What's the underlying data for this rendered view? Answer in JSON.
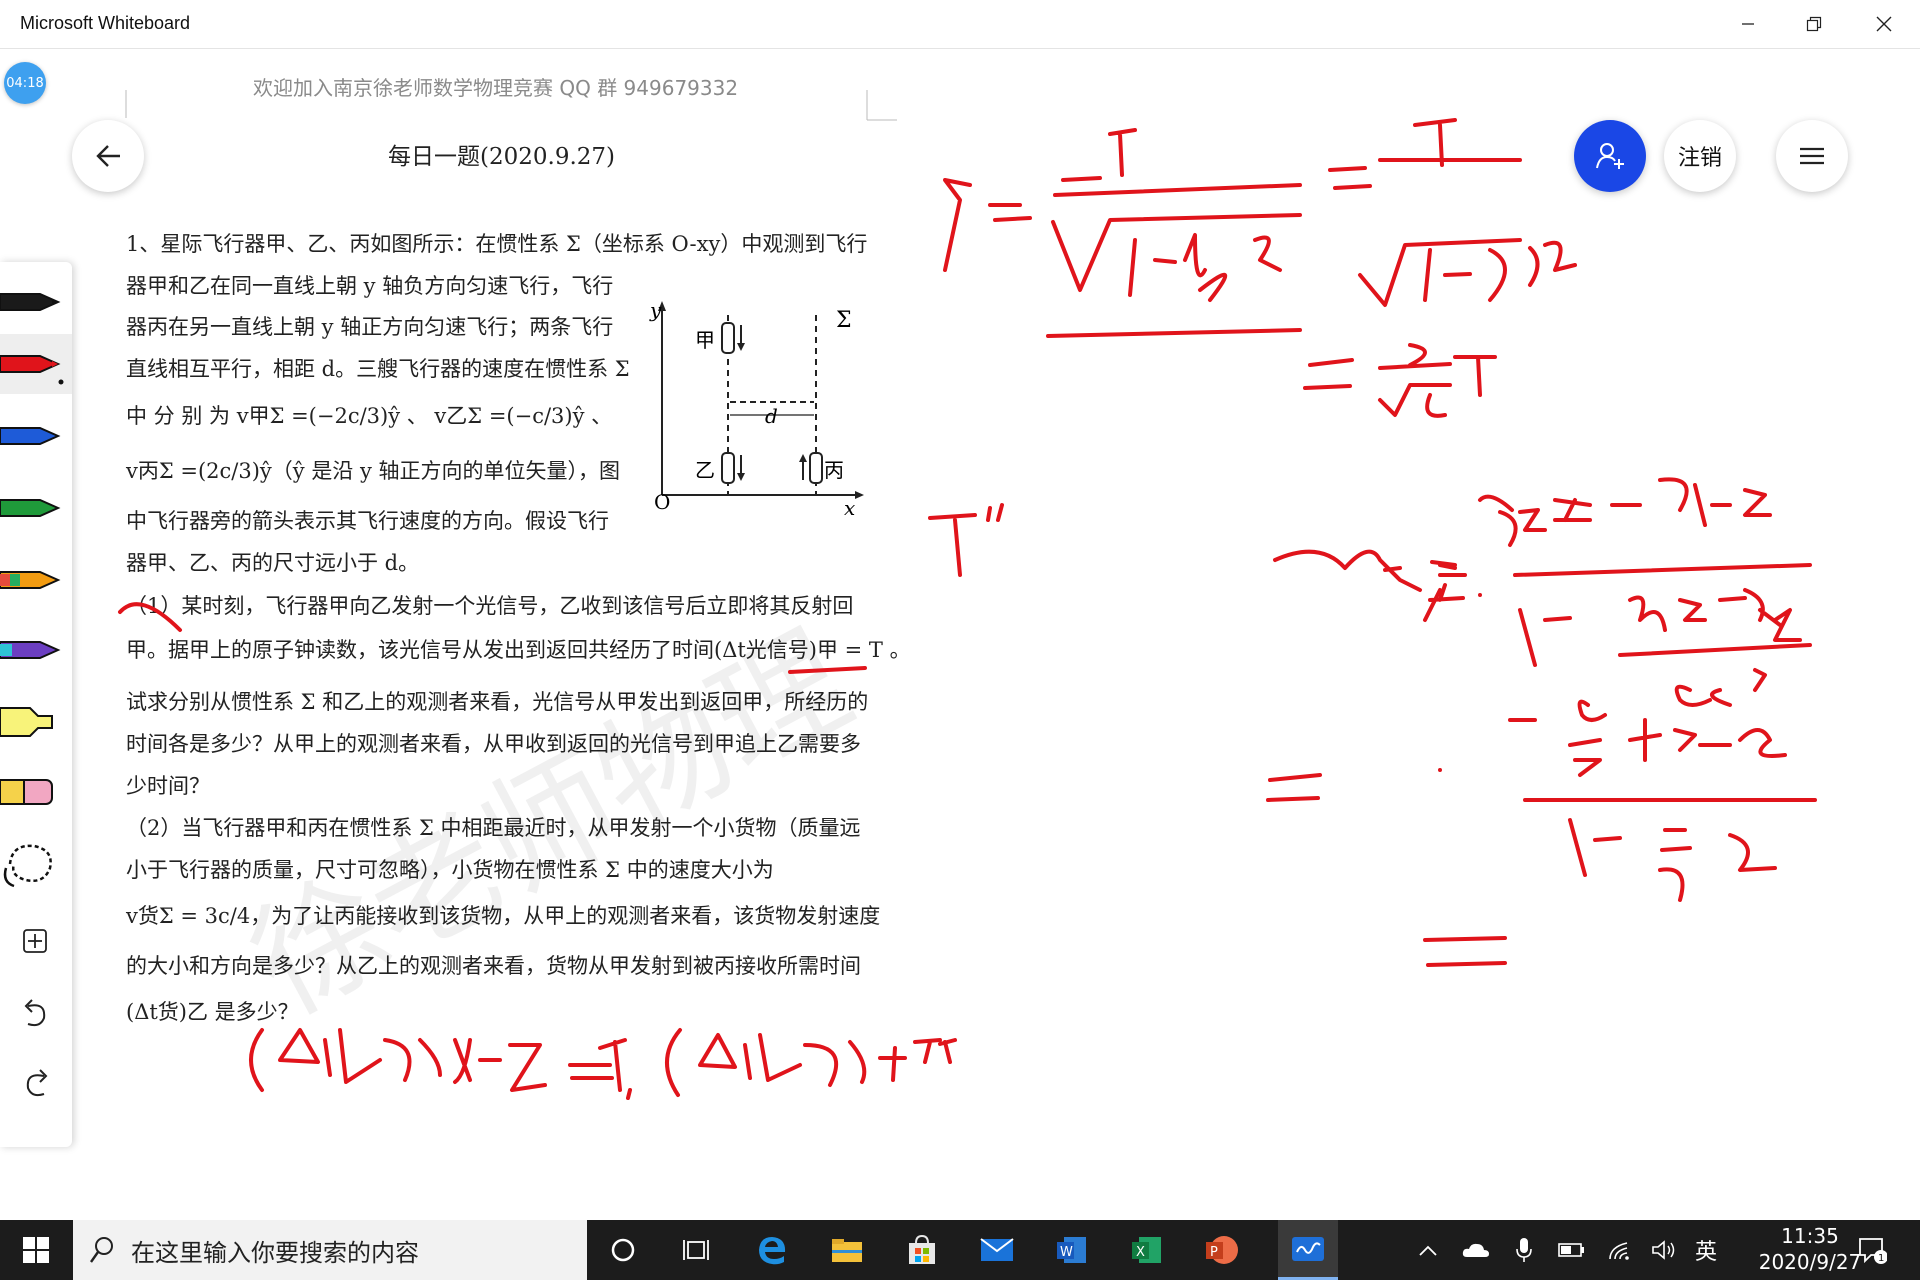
{
  "app": {
    "title": "Microsoft Whiteboard",
    "timer": "04:18",
    "signout_label": "注销"
  },
  "doc": {
    "header_note": "欢迎加入南京徐老师数学物理竞赛 QQ 群 949679332",
    "title": "每日一题(2020.9.27)",
    "lines": [
      "1、星际飞行器甲、乙、丙如图所示：在惯性系 Σ（坐标系 O-xy）中观测到飞行",
      "器甲和乙在同一直线上朝 y 轴负方向匀速飞行，飞行",
      "器丙在另一直线上朝 y 轴正方向匀速飞行；两条飞行",
      "直线相互平行，相距 d。三艘飞行器的速度在惯性系 Σ",
      "中 分 别 为  v甲Σ =(−2c/3)ŷ  、  v乙Σ =(−c/3)ŷ  、",
      "v丙Σ =(2c/3)ŷ（ŷ 是沿 y 轴正方向的单位矢量），图",
      "中飞行器旁的箭头表示其飞行速度的方向。假设飞行",
      "器甲、乙、丙的尺寸远小于 d。",
      "（1）某时刻，飞行器甲向乙发射一个光信号，乙收到该信号后立即将其反射回",
      "甲。据甲上的原子钟读数，该光信号从发出到返回共经历了时间(Δt光信号)甲 = T 。",
      "试求分别从惯性系 Σ 和乙上的观测者来看，光信号从甲发出到返回甲，所经历的",
      "时间各是多少？从甲上的观测者来看，从甲收到返回的光信号到甲追上乙需要多",
      "少时间？",
      "（2）当飞行器甲和丙在惯性系 Σ 中相距最近时，从甲发射一个小货物（质量远",
      "小于飞行器的质量，尺寸可忽略），小货物在惯性系 Σ 中的速度大小为",
      "v货Σ = 3c/4，为了让丙能接收到该货物，从甲上的观测者来看，该货物发射速度",
      "的大小和方向是多少？从乙上的观测者来看，货物从甲发射到被丙接收所需时间",
      "(Δt货)乙 是多少？"
    ]
  },
  "figure": {
    "y": "y",
    "sigma": "Σ",
    "jia": "甲",
    "yi": "乙",
    "bing": "丙",
    "d": "d",
    "o": "O",
    "x": "x"
  },
  "taskbar": {
    "search_placeholder": "在这里输入你要搜索的内容",
    "ime": "英",
    "time": "11:35",
    "date": "2020/9/27",
    "notif_count": "1"
  },
  "colors": {
    "ink": "#e0141b",
    "accent": "#1a47e6"
  },
  "chart_data": {
    "type": "table",
    "title": "",
    "columns": [],
    "rows": []
  }
}
